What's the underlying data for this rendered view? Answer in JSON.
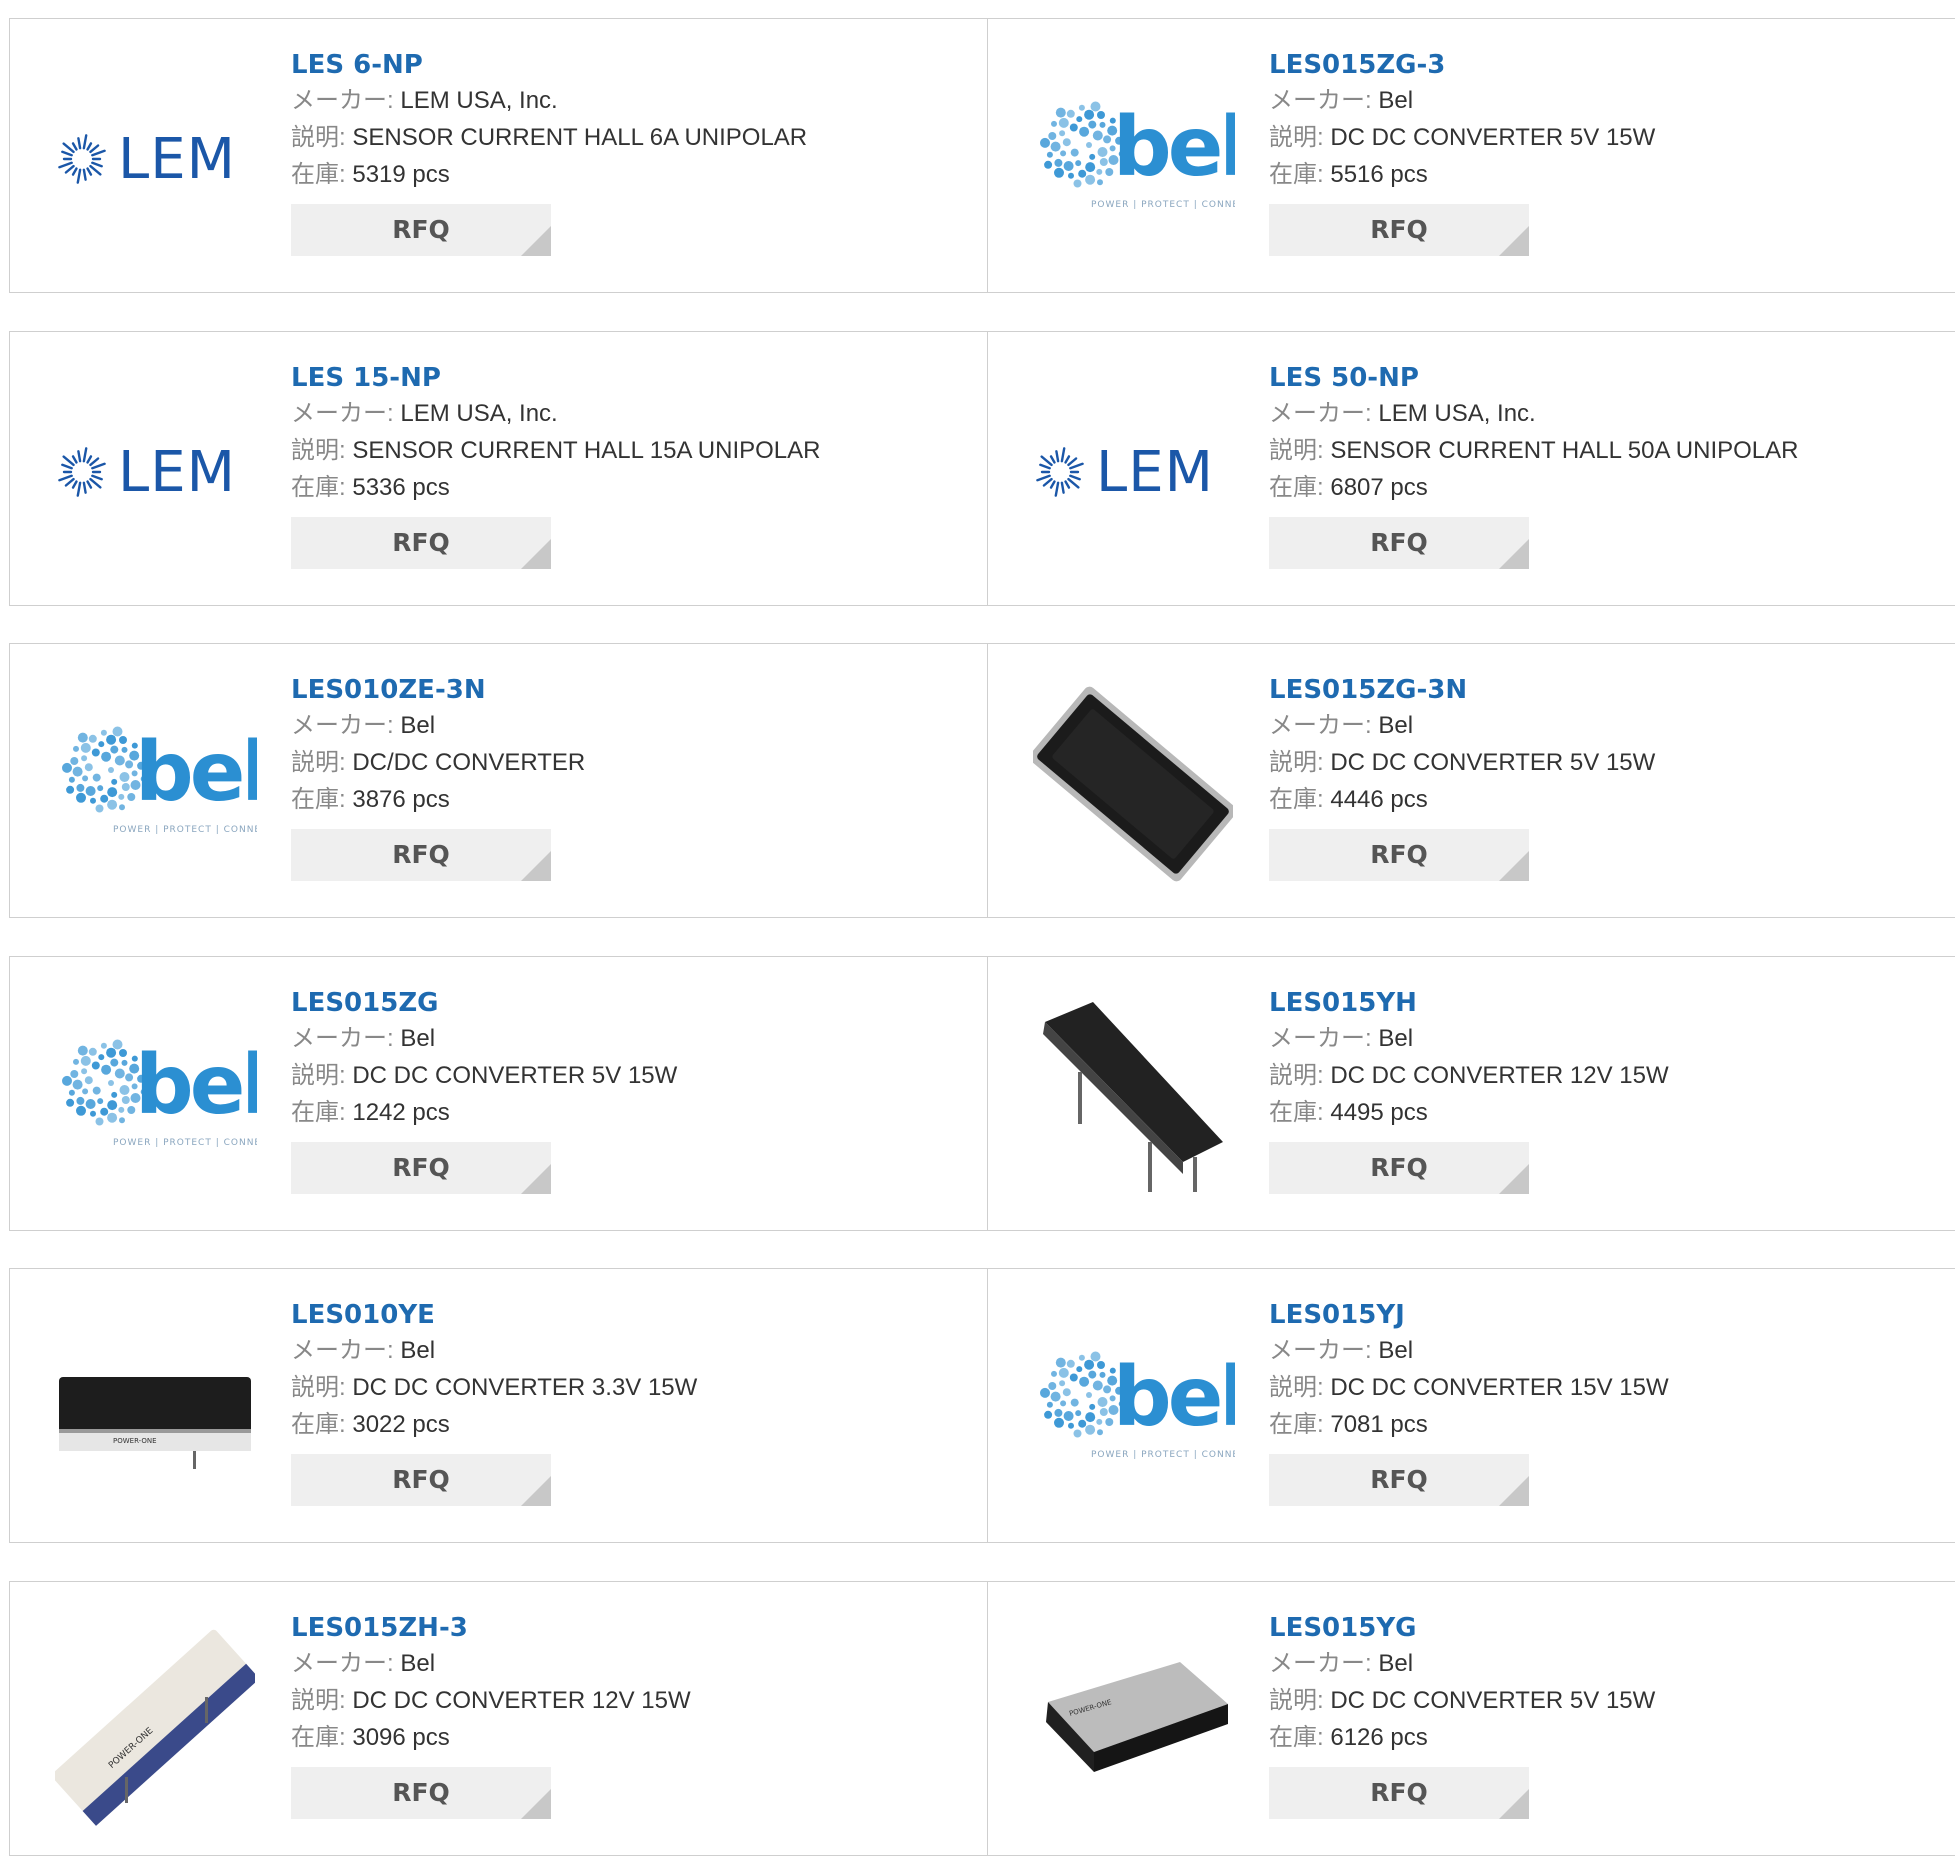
{
  "labels": {
    "maker": "メーカー:",
    "description": "説明:",
    "stock": "在庫:",
    "rfq": "RFQ"
  },
  "colors": {
    "title_link": "#1e6ab0",
    "bel_blue": "#2b8fd2",
    "lem_blue": "#1b57a8",
    "button_bg": "#efefef"
  },
  "products": [
    {
      "part": "LES 6-NP",
      "maker": "LEM USA, Inc.",
      "description": "SENSOR CURRENT HALL 6A UNIPOLAR",
      "stock": "5319 pcs",
      "image": "lem-logo"
    },
    {
      "part": "LES015ZG-3",
      "maker": "Bel",
      "description": "DC DC CONVERTER 5V 15W",
      "stock": "5516 pcs",
      "image": "bel-logo"
    },
    {
      "part": "LES 15-NP",
      "maker": "LEM USA, Inc.",
      "description": "SENSOR CURRENT HALL 15A UNIPOLAR",
      "stock": "5336 pcs",
      "image": "lem-logo"
    },
    {
      "part": "LES 50-NP",
      "maker": "LEM USA, Inc.",
      "description": "SENSOR CURRENT HALL 50A UNIPOLAR",
      "stock": "6807 pcs",
      "image": "lem-logo"
    },
    {
      "part": "LES010ZE-3N",
      "maker": "Bel",
      "description": "DC/DC CONVERTER",
      "stock": "3876 pcs",
      "image": "bel-logo"
    },
    {
      "part": "LES015ZG-3N",
      "maker": "Bel",
      "description": "DC DC CONVERTER 5V 15W",
      "stock": "4446 pcs",
      "image": "converter-top"
    },
    {
      "part": "LES015ZG",
      "maker": "Bel",
      "description": "DC DC CONVERTER 5V 15W",
      "stock": "1242 pcs",
      "image": "bel-logo"
    },
    {
      "part": "LES015YH",
      "maker": "Bel",
      "description": "DC DC CONVERTER 12V 15W",
      "stock": "4495 pcs",
      "image": "converter-angled"
    },
    {
      "part": "LES010YE",
      "maker": "Bel",
      "description": "DC DC CONVERTER 3.3V 15W",
      "stock": "3022 pcs",
      "image": "converter-side"
    },
    {
      "part": "LES015YJ",
      "maker": "Bel",
      "description": "DC DC CONVERTER 15V 15W",
      "stock": "7081 pcs",
      "image": "bel-logo"
    },
    {
      "part": "LES015ZH-3",
      "maker": "Bel",
      "description": "DC DC CONVERTER 12V 15W",
      "stock": "3096 pcs",
      "image": "converter-diagonal"
    },
    {
      "part": "LES015YG",
      "maker": "Bel",
      "description": "DC DC CONVERTER 5V 15W",
      "stock": "6126 pcs",
      "image": "converter-metal"
    }
  ]
}
